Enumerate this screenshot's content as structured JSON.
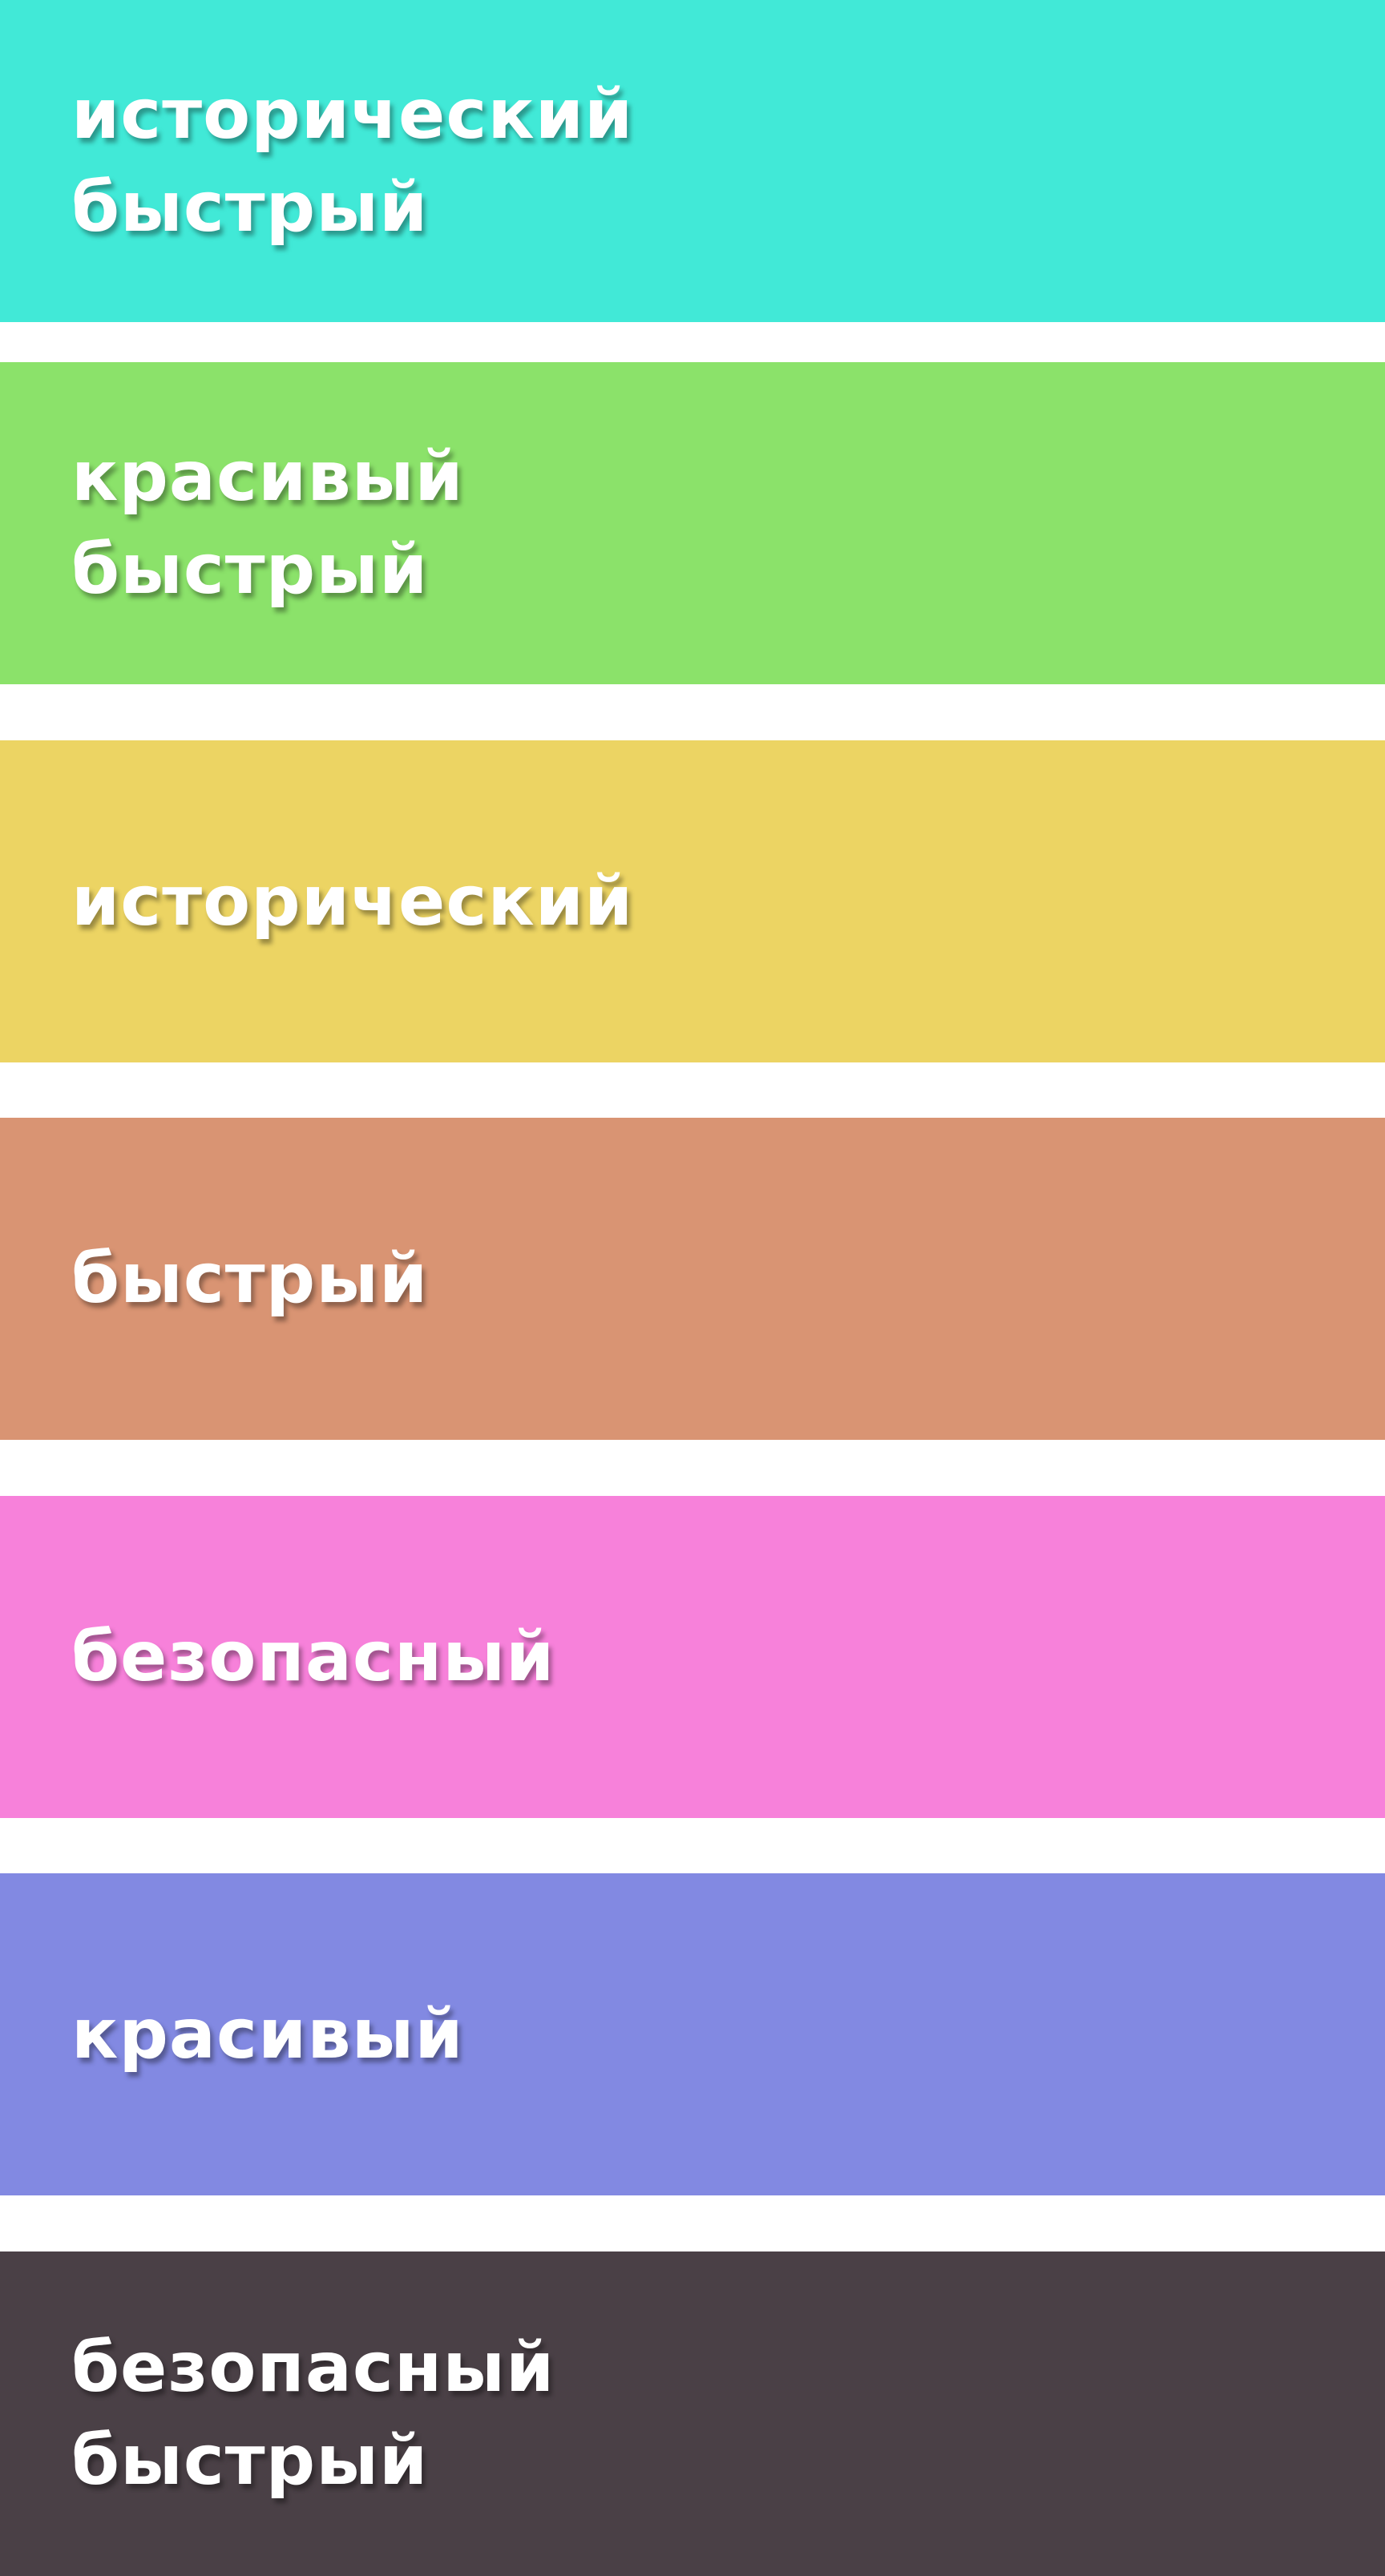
{
  "bands": [
    {
      "lines": [
        "исторический",
        "быстрый"
      ],
      "color": "#41E9D7"
    },
    {
      "lines": [
        "красивый",
        "быстрый"
      ],
      "color": "#8BE26A"
    },
    {
      "lines": [
        "исторический"
      ],
      "color": "#ECD463"
    },
    {
      "lines": [
        "быстрый"
      ],
      "color": "#D99473"
    },
    {
      "lines": [
        "безопасный"
      ],
      "color": "#F781DA"
    },
    {
      "lines": [
        "красивый"
      ],
      "color": "#8289E2"
    },
    {
      "lines": [
        "безопасный",
        "быстрый"
      ],
      "color": "#4A4046"
    }
  ]
}
